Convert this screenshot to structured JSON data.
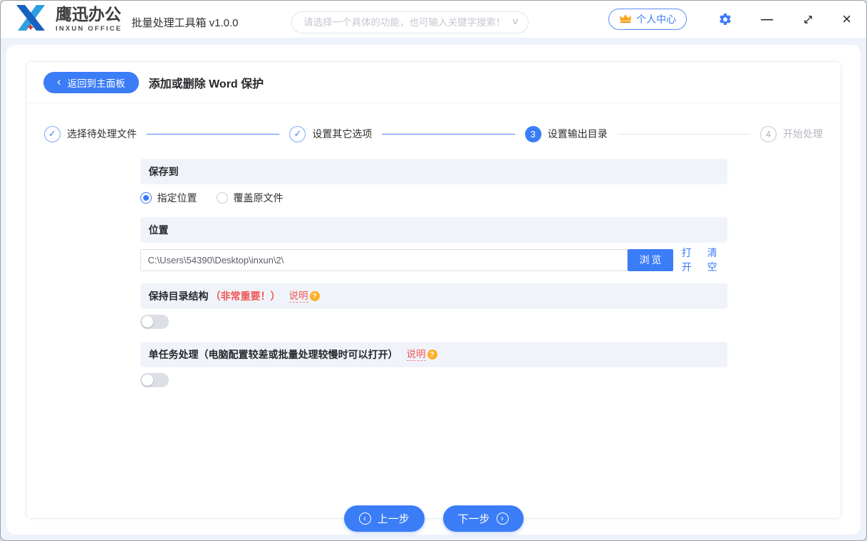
{
  "header": {
    "logo": {
      "title": "鹰迅办公",
      "subtitle": "INXUN OFFICE"
    },
    "app_title": "批量处理工具箱 v1.0.0",
    "search_placeholder": "请选择一个具体的功能，也可输入关键字搜索！",
    "user_center_label": "个人中心"
  },
  "toolbar": {
    "back_label": "返回到主面板",
    "page_title": "添加或删除 Word 保护"
  },
  "steps": [
    {
      "num": "1",
      "label": "选择待处理文件",
      "state": "done"
    },
    {
      "num": "2",
      "label": "设置其它选项",
      "state": "done"
    },
    {
      "num": "3",
      "label": "设置输出目录",
      "state": "current"
    },
    {
      "num": "4",
      "label": "开始处理",
      "state": "pending"
    }
  ],
  "save_to": {
    "header": "保存到",
    "option_specified": "指定位置",
    "option_overwrite": "覆盖原文件",
    "selected": "指定位置"
  },
  "location": {
    "header": "位置",
    "path": "C:\\Users\\54390\\Desktop\\inxun\\2\\",
    "browse_label": "浏览",
    "open_label": "打开",
    "clear_label": "清空"
  },
  "keep_structure": {
    "title": "保持目录结构",
    "warning": "（非常重要！）",
    "help_label": "说明",
    "enabled": false
  },
  "single_task": {
    "title": "单任务处理（电脑配置较差或批量处理较慢时可以打开）",
    "help_label": "说明",
    "enabled": false
  },
  "footer": {
    "prev_label": "上一步",
    "next_label": "下一步"
  },
  "icons": {
    "check": "✓",
    "chevron_left": "‹",
    "chevron_down": "∨",
    "minimize": "—",
    "close": "×",
    "question": "?",
    "prev_arrow": "‹",
    "next_arrow": "›"
  },
  "colors": {
    "accent": "#3b7cf7",
    "danger": "#f25454",
    "band_bg": "#f0f4fa",
    "page_bg": "#edf2fb",
    "help_badge": "#ffaf26"
  }
}
